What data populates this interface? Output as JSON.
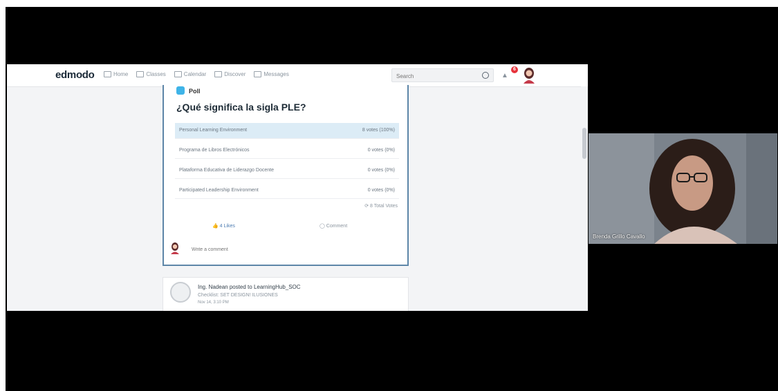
{
  "app": {
    "logo": "edmodo",
    "nav": [
      "Home",
      "Classes",
      "Calendar",
      "Discover",
      "Messages"
    ],
    "search_placeholder": "Search",
    "notification_count": "6"
  },
  "poll": {
    "label": "Poll",
    "question": "¿Qué significa la sigla PLE?",
    "options": [
      {
        "label": "Personal Learning Environment",
        "votes": "8 votes (100%)",
        "winner": true
      },
      {
        "label": "Programa de Libros Electrónicos",
        "votes": "0 votes (0%)",
        "winner": false
      },
      {
        "label": "Plataforma Educativa de Liderazgo Docente",
        "votes": "0 votes (0%)",
        "winner": false
      },
      {
        "label": "Participated Leadership Environment",
        "votes": "0 votes (0%)",
        "winner": false
      }
    ],
    "total_votes": "8 Total Votes",
    "like_label": "4 Likes",
    "comment_label": "Comment",
    "comment_placeholder": "Write a comment"
  },
  "post": {
    "line1": "Ing. Nadean posted to LearningHub_SOC",
    "line2": "Checklist: SET DESIGN! ILUSIONES",
    "line3": "Nov 14, 3:10 PM"
  },
  "webcam": {
    "name": "Brenda Grillo Cavallo"
  },
  "colors": {
    "poll_border": "#5d86a8",
    "winner_fill": "#dcecf6",
    "poll_icon": "#3fb4e8",
    "badge": "#e7333c"
  }
}
